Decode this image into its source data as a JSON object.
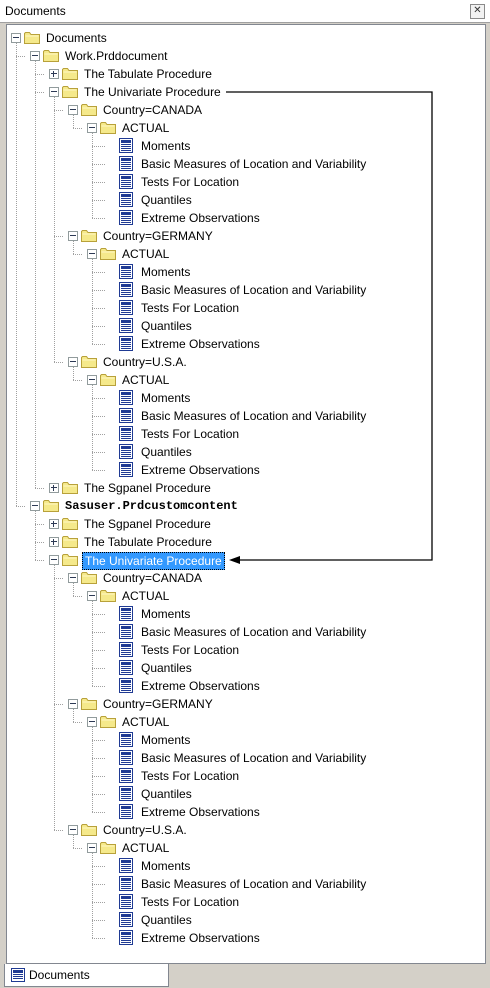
{
  "window": {
    "title": "Documents",
    "close_glyph": "✕"
  },
  "tree": [
    {
      "level": 0,
      "icon": "folder-icon",
      "label": "Documents",
      "expander": "minus"
    },
    {
      "level": 1,
      "icon": "folder-icon",
      "label": "Work.Prddocument",
      "expander": "minus"
    },
    {
      "level": 2,
      "icon": "folder-icon",
      "label": "The Tabulate Procedure",
      "expander": "plus"
    },
    {
      "level": 2,
      "icon": "folder-icon",
      "label": "The Univariate Procedure",
      "expander": "minus"
    },
    {
      "level": 3,
      "icon": "folder-icon",
      "label": "Country=CANADA",
      "expander": "minus"
    },
    {
      "level": 4,
      "icon": "folder-icon",
      "label": "ACTUAL",
      "expander": "minus"
    },
    {
      "level": 5,
      "icon": "document-icon",
      "label": "Moments"
    },
    {
      "level": 5,
      "icon": "document-icon",
      "label": "Basic Measures of Location and Variability"
    },
    {
      "level": 5,
      "icon": "document-icon",
      "label": "Tests For Location"
    },
    {
      "level": 5,
      "icon": "document-icon",
      "label": "Quantiles"
    },
    {
      "level": 5,
      "icon": "document-icon",
      "label": "Extreme Observations"
    },
    {
      "level": 3,
      "icon": "folder-icon",
      "label": "Country=GERMANY",
      "expander": "minus"
    },
    {
      "level": 4,
      "icon": "folder-icon",
      "label": "ACTUAL",
      "expander": "minus"
    },
    {
      "level": 5,
      "icon": "document-icon",
      "label": "Moments"
    },
    {
      "level": 5,
      "icon": "document-icon",
      "label": "Basic Measures of Location and Variability"
    },
    {
      "level": 5,
      "icon": "document-icon",
      "label": "Tests For Location"
    },
    {
      "level": 5,
      "icon": "document-icon",
      "label": "Quantiles"
    },
    {
      "level": 5,
      "icon": "document-icon",
      "label": "Extreme Observations"
    },
    {
      "level": 3,
      "icon": "folder-icon",
      "label": "Country=U.S.A.",
      "expander": "minus"
    },
    {
      "level": 4,
      "icon": "folder-icon",
      "label": "ACTUAL",
      "expander": "minus"
    },
    {
      "level": 5,
      "icon": "document-icon",
      "label": "Moments"
    },
    {
      "level": 5,
      "icon": "document-icon",
      "label": "Basic Measures of Location and Variability"
    },
    {
      "level": 5,
      "icon": "document-icon",
      "label": "Tests For Location"
    },
    {
      "level": 5,
      "icon": "document-icon",
      "label": "Quantiles"
    },
    {
      "level": 5,
      "icon": "document-icon",
      "label": "Extreme Observations"
    },
    {
      "level": 2,
      "icon": "folder-icon",
      "label": "The Sgpanel Procedure",
      "expander": "plus"
    },
    {
      "level": 1,
      "icon": "folder-icon",
      "label": "Sasuser.Prdcustomcontent",
      "expander": "minus",
      "mono": true
    },
    {
      "level": 2,
      "icon": "folder-icon",
      "label": "The Sgpanel Procedure",
      "expander": "plus"
    },
    {
      "level": 2,
      "icon": "folder-icon",
      "label": "The Tabulate Procedure",
      "expander": "plus"
    },
    {
      "level": 2,
      "icon": "folder-icon",
      "label": "The Univariate Procedure",
      "expander": "minus",
      "selected": true
    },
    {
      "level": 3,
      "icon": "folder-icon",
      "label": "Country=CANADA",
      "expander": "minus"
    },
    {
      "level": 4,
      "icon": "folder-icon",
      "label": "ACTUAL",
      "expander": "minus"
    },
    {
      "level": 5,
      "icon": "document-icon",
      "label": "Moments"
    },
    {
      "level": 5,
      "icon": "document-icon",
      "label": "Basic Measures of Location and Variability"
    },
    {
      "level": 5,
      "icon": "document-icon",
      "label": "Tests For Location"
    },
    {
      "level": 5,
      "icon": "document-icon",
      "label": "Quantiles"
    },
    {
      "level": 5,
      "icon": "document-icon",
      "label": "Extreme Observations"
    },
    {
      "level": 3,
      "icon": "folder-icon",
      "label": "Country=GERMANY",
      "expander": "minus"
    },
    {
      "level": 4,
      "icon": "folder-icon",
      "label": "ACTUAL",
      "expander": "minus"
    },
    {
      "level": 5,
      "icon": "document-icon",
      "label": "Moments"
    },
    {
      "level": 5,
      "icon": "document-icon",
      "label": "Basic Measures of Location and Variability"
    },
    {
      "level": 5,
      "icon": "document-icon",
      "label": "Tests For Location"
    },
    {
      "level": 5,
      "icon": "document-icon",
      "label": "Quantiles"
    },
    {
      "level": 5,
      "icon": "document-icon",
      "label": "Extreme Observations"
    },
    {
      "level": 3,
      "icon": "folder-icon",
      "label": "Country=U.S.A.",
      "expander": "minus"
    },
    {
      "level": 4,
      "icon": "folder-icon",
      "label": "ACTUAL",
      "expander": "minus"
    },
    {
      "level": 5,
      "icon": "document-icon",
      "label": "Moments"
    },
    {
      "level": 5,
      "icon": "document-icon",
      "label": "Basic Measures of Location and Variability"
    },
    {
      "level": 5,
      "icon": "document-icon",
      "label": "Tests For Location"
    },
    {
      "level": 5,
      "icon": "document-icon",
      "label": "Quantiles"
    },
    {
      "level": 5,
      "icon": "document-icon",
      "label": "Extreme Observations"
    }
  ],
  "tabs": [
    {
      "label": "Documents",
      "icon": "document-icon",
      "active": true
    }
  ],
  "colors": {
    "selection": "#3399ff",
    "folder": "#f5e98b",
    "folder_border": "#b8a13a",
    "doc_blue": "#1f3a93"
  }
}
